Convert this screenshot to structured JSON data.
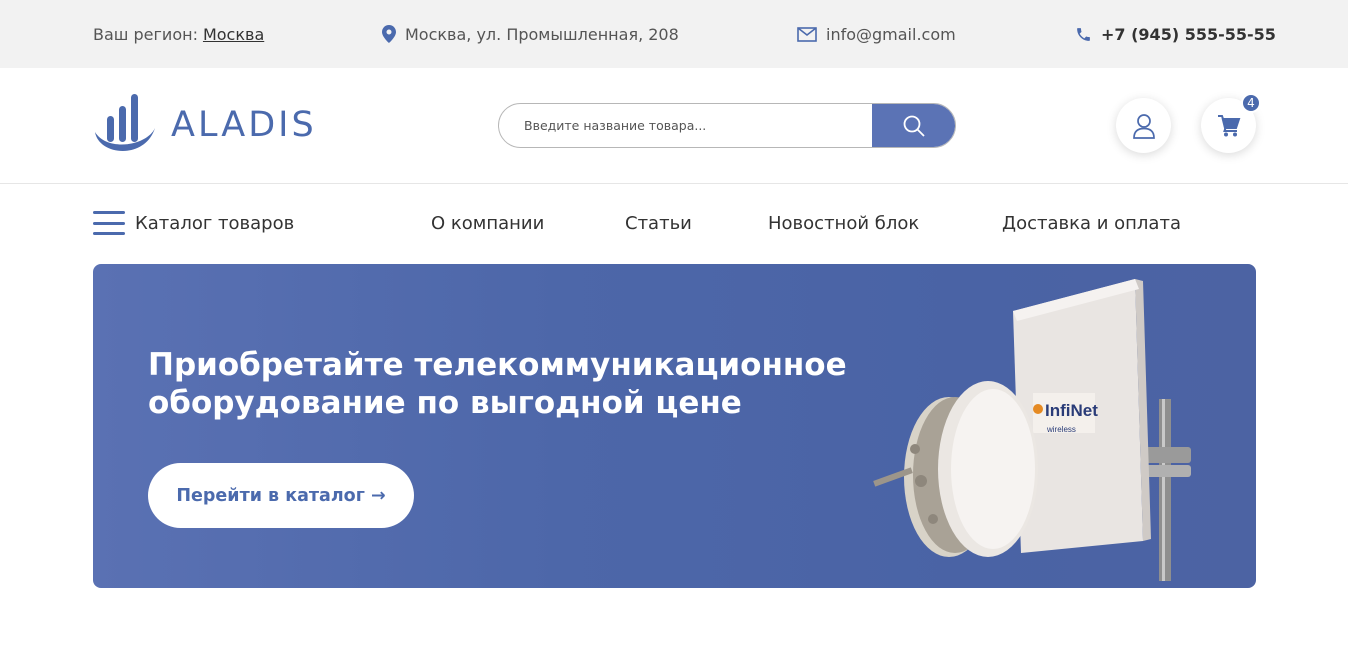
{
  "topbar": {
    "region_label": "Ваш регион:",
    "region_value": "Москва",
    "address": "Москва, ул. Промышленная, 208",
    "email": "info@gmail.com",
    "phone": "+7 (945) 555-55-55"
  },
  "header": {
    "logo_text": "ALADIS",
    "search_placeholder": "Введите название товара...",
    "cart_count": "4"
  },
  "nav": {
    "catalog_label": "Каталог товаров",
    "links": [
      "О компании",
      "Статьи",
      "Новостной блок",
      "Доставка и оплата"
    ]
  },
  "banner": {
    "title": "Приобретайте телекоммуникационное оборудование по выгодной цене",
    "button_label": "Перейти в каталог →",
    "product_brand": "InfiNet",
    "product_sub": "wireless"
  },
  "colors": {
    "accent": "#4b6aad",
    "search_button": "#5b73b5",
    "topbar_bg": "#f2f2f2"
  }
}
